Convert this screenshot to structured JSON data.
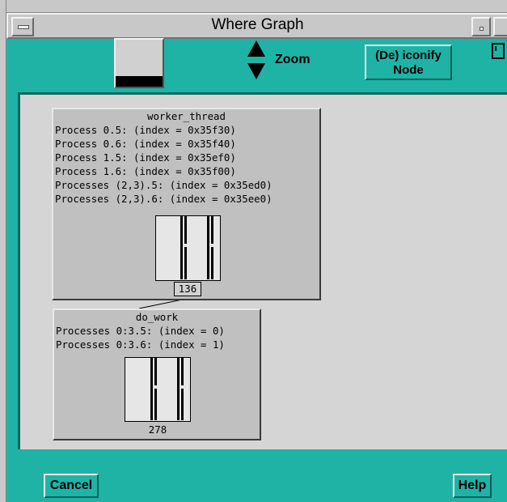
{
  "window": {
    "title": "Where Graph"
  },
  "toolbar": {
    "zoom_label": "Zoom",
    "iconify_label_line1": "(De) iconify",
    "iconify_label_line2": "Node"
  },
  "nodes": [
    {
      "title": "worker_thread",
      "lines": [
        "Process 0.5: (index = 0x35f30)",
        "Process 0.6: (index = 0x35f40)",
        "Process 1.5: (index = 0x35ef0)",
        "Process 1.6: (index = 0x35f00)",
        "Processes (2,3).5: (index = 0x35ed0)",
        "Processes (2,3).6: (index = 0x35ee0)"
      ],
      "count": "136"
    },
    {
      "title": "do_work",
      "lines": [
        "Processes 0:3.5: (index = 0)",
        "Processes 0:3.6: (index = 1)"
      ],
      "count": "278"
    }
  ],
  "buttons": {
    "cancel": "Cancel",
    "help": "Help"
  },
  "colors": {
    "window_bg": "#1fb3a6",
    "canvas_bg": "#d5d5d5",
    "node_bg": "#c0c0c0"
  }
}
